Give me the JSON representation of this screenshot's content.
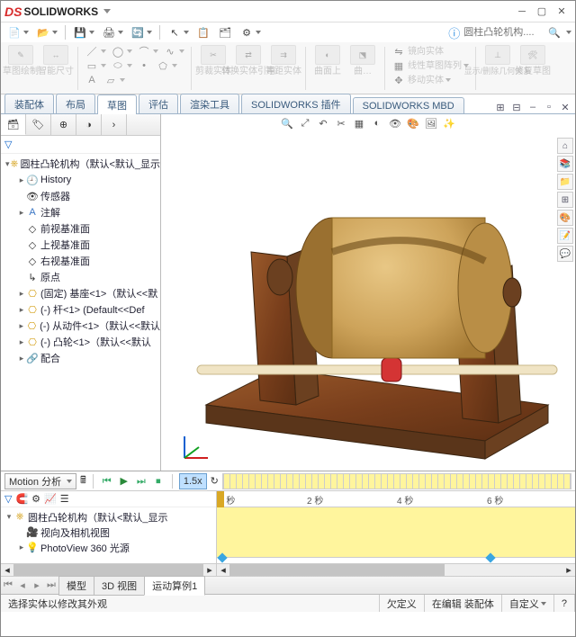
{
  "title": {
    "brand_prefix": "DS",
    "brand": "SOLIDWORKS"
  },
  "doc_search_placeholder": "圆柱凸轮机构....",
  "ribbon": {
    "g1": {
      "a": "草图绘制",
      "b": "智能尺寸"
    },
    "g2": {
      "a": "剪裁实体",
      "b": "转换实体引用",
      "c": "等距实体"
    },
    "g3": {
      "a": "曲面上",
      "b": "曲…"
    },
    "g4": {
      "a": "镜向实体",
      "b": "线性草图阵列",
      "c": "移动实体"
    },
    "g5": {
      "a": "显示/删除几何关系",
      "b": "修复草图"
    }
  },
  "tabs": [
    "装配体",
    "布局",
    "草图",
    "评估",
    "渲染工具",
    "SOLIDWORKS 插件",
    "SOLIDWORKS MBD"
  ],
  "active_tab": 2,
  "feature_tree": {
    "root": "圆柱凸轮机构（默认<默认_显示",
    "history": "History",
    "sensors": "传感器",
    "annotations": "注解",
    "front": "前视基准面",
    "top": "上视基准面",
    "right": "右视基准面",
    "origin": "原点",
    "p1": "(固定) 基座<1>（默认<<默",
    "p2": "(-) 杆<1> (Default<<Def",
    "p3": "(-) 从动件<1>（默认<<默认",
    "p4": "(-) 凸轮<1>（默认<<默认",
    "mates": "配合"
  },
  "motion": {
    "dropdown": "Motion 分析",
    "speed": "1.5x",
    "time_labels": [
      "0 秒",
      "2 秒",
      "4 秒",
      "6 秒"
    ]
  },
  "motion_tree": {
    "root": "圆柱凸轮机构（默认<默认_显示",
    "views": "视向及相机视图",
    "pv": "PhotoView 360 光源"
  },
  "bottom_tabs": [
    "模型",
    "3D 视图",
    "运动算例1"
  ],
  "status_bar": {
    "hint": "选择实体以修改其外观",
    "undef": "欠定义",
    "state": "在编辑 装配体",
    "custom": "自定义"
  }
}
